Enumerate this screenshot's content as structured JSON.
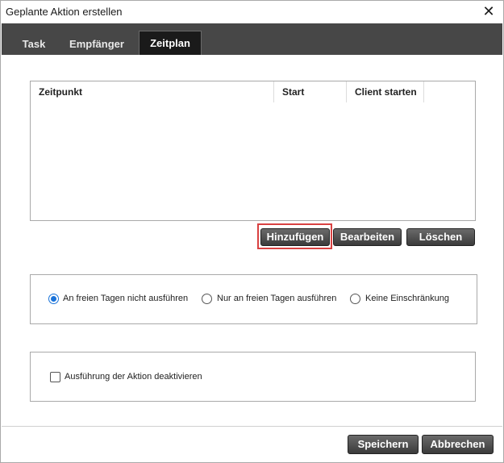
{
  "window": {
    "title": "Geplante Aktion erstellen"
  },
  "tabs": [
    {
      "label": "Task",
      "active": false
    },
    {
      "label": "Empfänger",
      "active": false
    },
    {
      "label": "Zeitplan",
      "active": true
    }
  ],
  "schedule_table": {
    "columns": [
      "Zeitpunkt",
      "Start",
      "Client starten"
    ],
    "rows": []
  },
  "table_actions": {
    "add_label": "Hinzufügen",
    "edit_label": "Bearbeiten",
    "delete_label": "Löschen"
  },
  "free_days": {
    "options": [
      {
        "label": "An freien Tagen nicht ausführen",
        "checked": true
      },
      {
        "label": "Nur an freien Tagen ausführen",
        "checked": false
      },
      {
        "label": "Keine Einschränkung",
        "checked": false
      }
    ]
  },
  "deactivate": {
    "label": "Ausführung der Aktion deaktivieren",
    "checked": false
  },
  "footer": {
    "save_label": "Speichern",
    "cancel_label": "Abbrechen"
  },
  "colors": {
    "accent": "#1a73d9",
    "highlight": "#d94141",
    "tabbar": "#474747"
  }
}
